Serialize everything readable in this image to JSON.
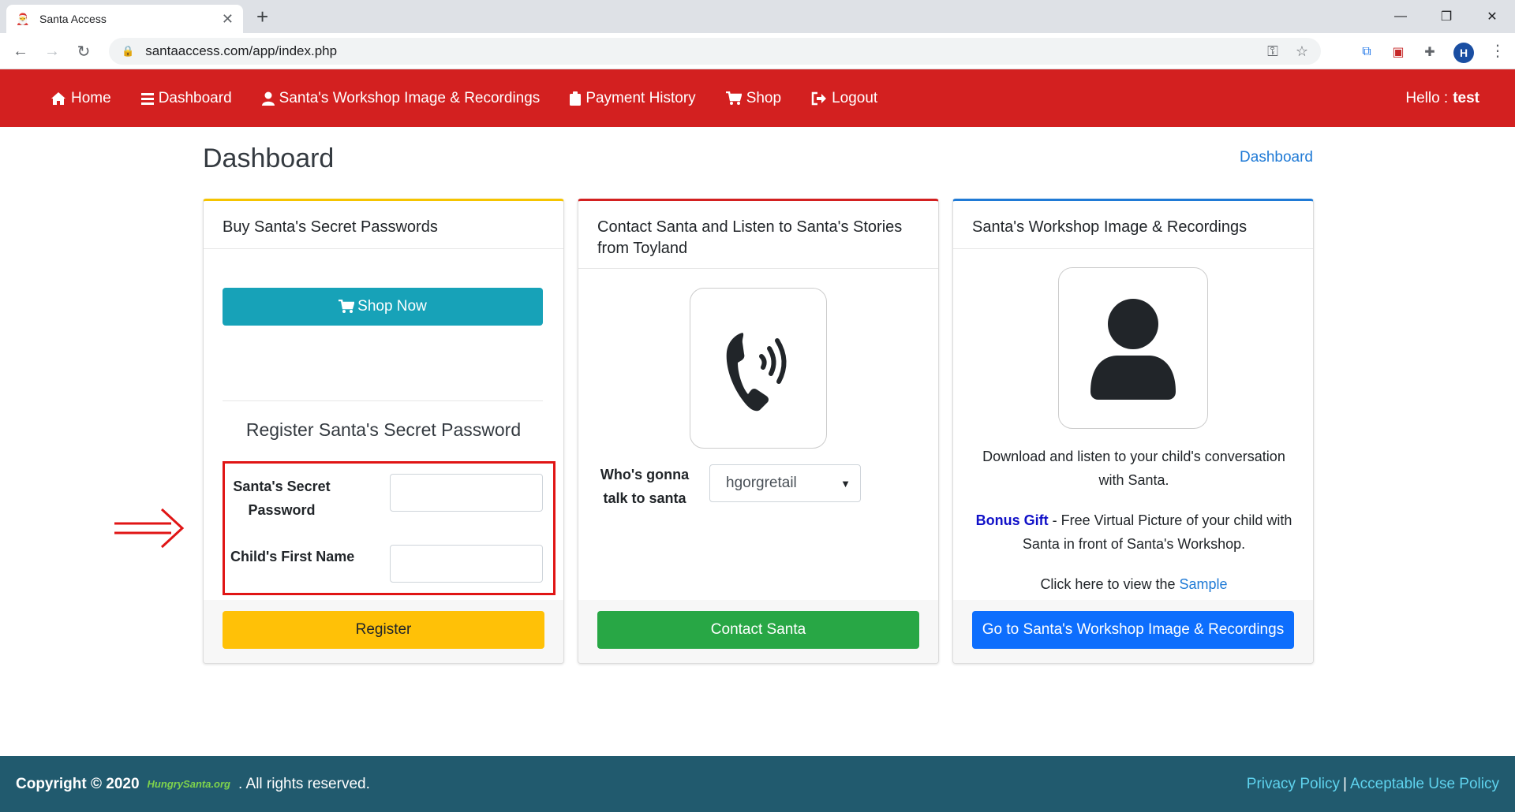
{
  "browser": {
    "tab_title": "Santa Access",
    "tab_close": "✕",
    "new_tab": "+",
    "url": "santaaccess.com/app/index.php",
    "profile_initial": "H",
    "window_controls": [
      "—",
      "❐",
      "✕"
    ]
  },
  "nav": {
    "items": [
      {
        "label": "Home",
        "icon": "home-icon"
      },
      {
        "label": "Dashboard",
        "icon": "bars-icon"
      },
      {
        "label": "Santa's Workshop Image & Recordings",
        "icon": "user-icon"
      },
      {
        "label": "Payment History",
        "icon": "clipboard-icon"
      },
      {
        "label": "Shop",
        "icon": "cart-icon"
      },
      {
        "label": "Logout",
        "icon": "logout-icon"
      }
    ],
    "hello_label": "Hello :",
    "username": "test"
  },
  "page": {
    "title": "Dashboard",
    "breadcrumb": "Dashboard"
  },
  "card_passwords": {
    "header": "Buy Santa's Secret Passwords",
    "shop_button": "Shop Now",
    "register_title": "Register Santa's Secret Password",
    "password_label_1": "Santa's Secret",
    "password_label_2": "Password",
    "password_value": "",
    "child_name_label": "Child's First Name",
    "child_name_value": "",
    "register_button": "Register"
  },
  "card_contact": {
    "header": "Contact Santa and Listen to Santa's Stories from Toyland",
    "who_label_1": "Who's gonna",
    "who_label_2": "talk to santa",
    "selected_child": "hgorgretail",
    "contact_button": "Contact Santa"
  },
  "card_workshop": {
    "header": "Santa's Workshop Image & Recordings",
    "desc": "Download and listen to your child's conversation with Santa.",
    "bonus_label": "Bonus Gift",
    "bonus_text": " - Free Virtual Picture of your child with Santa in front of Santa's Workshop.",
    "sample_prefix": "Click here to view the ",
    "sample_link": "Sample",
    "workshop_button": "Go to Santa's Workshop Image & Recordings"
  },
  "footer": {
    "copyright": "Copyright © 2020",
    "logo_text": "HungrySanta.org",
    "rights": ". All rights reserved.",
    "privacy_link": "Privacy Policy",
    "separator": "|",
    "aup_link": "Acceptable Use Policy"
  },
  "colors": {
    "navbar": "#d32020",
    "footer": "#215a6e",
    "annotation": "#e01515"
  }
}
